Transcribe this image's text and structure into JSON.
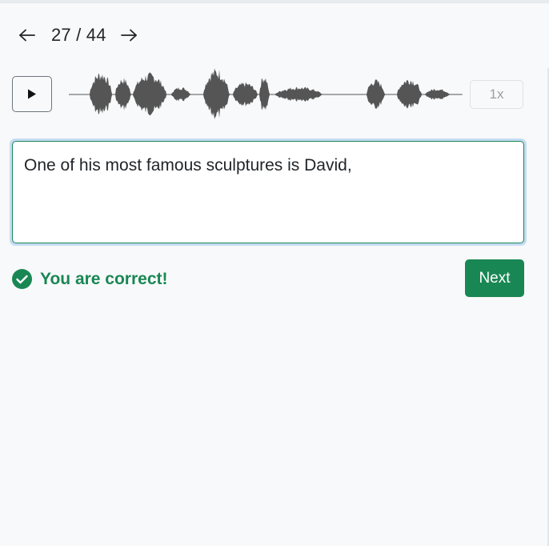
{
  "navigation": {
    "prev_icon": "arrow-left-icon",
    "next_icon": "arrow-right-icon",
    "counter": "27 / 44"
  },
  "player": {
    "play_icon": "play-icon",
    "speed_label": "1x"
  },
  "answer": {
    "text": "One of his most famous sculptures is David,"
  },
  "feedback": {
    "icon": "check-circle-icon",
    "message": "You are correct!"
  },
  "actions": {
    "next_label": "Next"
  },
  "colors": {
    "success": "#198754",
    "waveform": "#555555",
    "focus_ring": "#c6dcf3"
  }
}
